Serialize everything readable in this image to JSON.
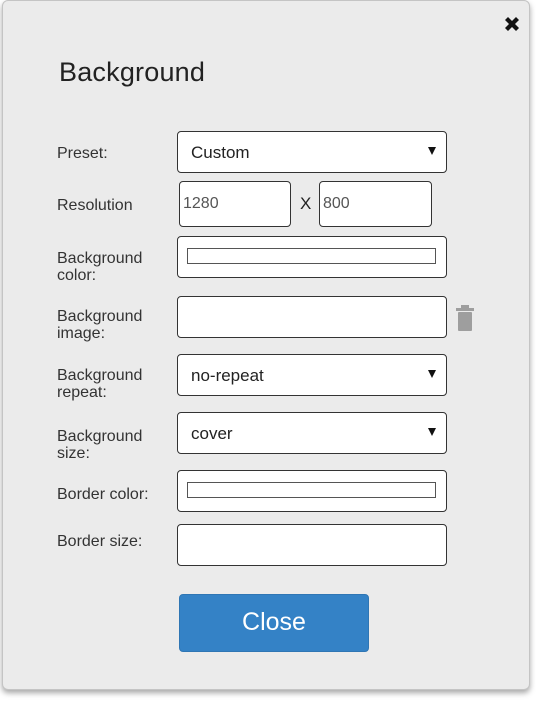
{
  "dialog": {
    "title": "Background",
    "close_icon": "close-x-icon"
  },
  "form": {
    "preset": {
      "label": "Preset:",
      "value": "Custom"
    },
    "resolution": {
      "label": "Resolution",
      "width": "1280",
      "separator": "X",
      "height": "800"
    },
    "background_color": {
      "label_line1": "Background",
      "label_line2": "color:",
      "value": "#ffffff"
    },
    "background_image": {
      "label_line1": "Background",
      "label_line2": "image:",
      "value": "",
      "delete_icon": "trash-icon"
    },
    "background_repeat": {
      "label_line1": "Background",
      "label_line2": "repeat:",
      "value": "no-repeat"
    },
    "background_size": {
      "label_line1": "Background",
      "label_line2": "size:",
      "value": "cover"
    },
    "border_color": {
      "label": "Border color:",
      "value": "#ffffff"
    },
    "border_size": {
      "label": "Border size:",
      "value": ""
    }
  },
  "footer": {
    "close_label": "Close"
  },
  "colors": {
    "dialog_bg": "#ebebeb",
    "primary_button": "#3482c6",
    "trash_icon": "#9e9e9e"
  }
}
